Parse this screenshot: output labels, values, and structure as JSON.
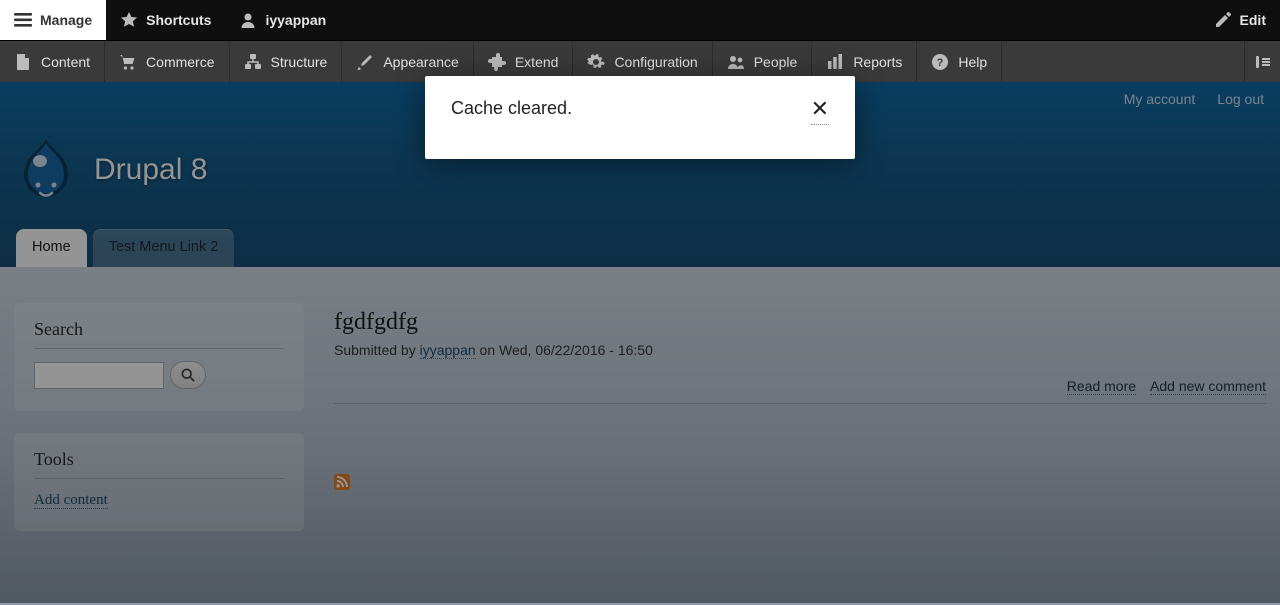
{
  "toolbar_top": {
    "manage": "Manage",
    "shortcuts": "Shortcuts",
    "user": "iyyappan",
    "edit": "Edit"
  },
  "toolbar_admin": {
    "items": [
      {
        "label": "Content"
      },
      {
        "label": "Commerce"
      },
      {
        "label": "Structure"
      },
      {
        "label": "Appearance"
      },
      {
        "label": "Extend"
      },
      {
        "label": "Configuration"
      },
      {
        "label": "People"
      },
      {
        "label": "Reports"
      },
      {
        "label": "Help"
      }
    ]
  },
  "message": {
    "text": "Cache cleared.",
    "close_symbol": "✕"
  },
  "utility": {
    "my_account": "My account",
    "log_out": "Log out"
  },
  "branding": {
    "site_name": "Drupal 8"
  },
  "tabs": [
    {
      "label": "Home",
      "active": true
    },
    {
      "label": "Test Menu Link 2",
      "active": false
    }
  ],
  "sidebar": {
    "search_heading": "Search",
    "search_placeholder": "",
    "tools_heading": "Tools",
    "add_content": "Add content"
  },
  "node": {
    "title": "fgdfgdfg",
    "submitted_prefix": "Submitted by ",
    "author": "iyyappan",
    "submitted_suffix": " on Wed, 06/22/2016 - 16:50",
    "read_more": "Read more",
    "add_comment": "Add new comment"
  }
}
